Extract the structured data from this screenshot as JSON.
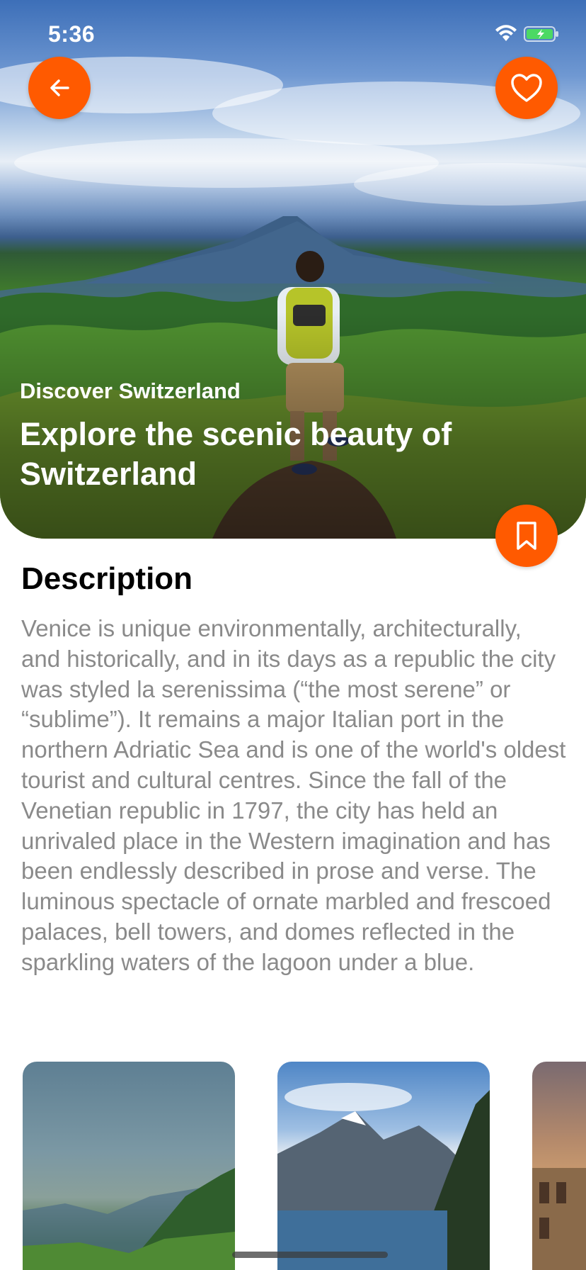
{
  "status_bar": {
    "time": "5:36"
  },
  "hero": {
    "subtitle": "Discover Switzerland",
    "title": "Explore the scenic beauty of Switzerland"
  },
  "buttons": {
    "back_icon": "arrow-left-icon",
    "favorite_icon": "heart-icon",
    "bookmark_icon": "bookmark-icon"
  },
  "description": {
    "heading": "Description",
    "body": "Venice is unique environmentally, architecturally, and historically, and in its days as a republic the city was styled la serenissima (“the most serene” or “sublime”). It remains a major Italian port in the northern Adriatic Sea and is one of the world's oldest tourist and cultural centres. Since the fall of the Venetian republic in 1797, the city has held an unrivaled place in the Western imagination and has been endlessly described in prose and verse. The luminous spectacle of ornate marbled and frescoed palaces, bell towers, and domes reflected in the sparkling waters of the lagoon under a blue."
  },
  "colors": {
    "accent": "#ff5a00",
    "heading_text": "#000000",
    "body_text": "#8a8a8a"
  }
}
